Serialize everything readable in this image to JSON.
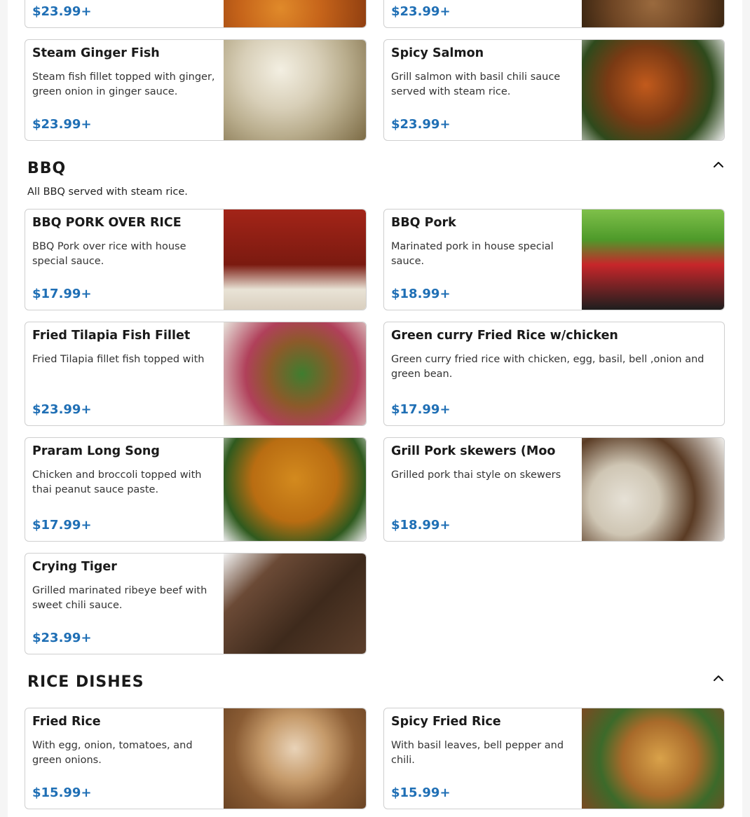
{
  "sections": {
    "top": {
      "items": [
        {
          "price": "$23.99+"
        },
        {
          "price": "$23.99+"
        },
        {
          "name": "Steam Ginger Fish",
          "description": "Steam fish fillet topped with ginger, green onion in ginger sauce.",
          "price": "$23.99+"
        },
        {
          "name": "Spicy Salmon",
          "description": "Grill salmon with basil chili sauce served with steam rice.",
          "price": "$23.99+"
        }
      ]
    },
    "bbq": {
      "title": "BBQ",
      "subtitle": "All BBQ served with steam rice.",
      "toggle_icon": "chevron-up-icon",
      "items": [
        {
          "name": "BBQ PORK OVER RICE",
          "description": "BBQ Pork over rice with house special sauce.",
          "price": "$17.99+"
        },
        {
          "name": "BBQ Pork",
          "description": "Marinated pork in house special sauce.",
          "price": "$18.99+"
        },
        {
          "name": "Fried Tilapia Fish Fillet larb salad",
          "description": "Fried Tilapia fillet fish topped with spicy lime dressing",
          "price": "$23.99+"
        },
        {
          "name": "Green curry Fried Rice w/chicken",
          "description": "Green curry fried rice with chicken, egg, basil, bell ,onion and green bean.",
          "price": "$17.99+"
        },
        {
          "name": "Praram Long Song",
          "description": "Chicken and broccoli topped with thai peanut sauce paste.",
          "price": "$17.99+"
        },
        {
          "name": "Grill Pork skewers (Moo Ping)",
          "description": "Grilled pork thai style on skewers served with sticky rice",
          "price": "$18.99+"
        },
        {
          "name": "Crying Tiger",
          "description": "Grilled marinated ribeye beef with sweet chili sauce.",
          "price": "$23.99+"
        }
      ]
    },
    "rice": {
      "title": "RICE DISHES",
      "toggle_icon": "chevron-up-icon",
      "items": [
        {
          "name": "Fried Rice",
          "description": "With egg, onion, tomatoes, and green onions.",
          "price": "$15.99+"
        },
        {
          "name": "Spicy Fried Rice",
          "description": "With basil leaves, bell pepper and chili.",
          "price": "$15.99+"
        }
      ]
    }
  },
  "colors": {
    "price": "#1f6fb5",
    "border": "#cfcfcf",
    "page_background": "#f5f5f5"
  }
}
